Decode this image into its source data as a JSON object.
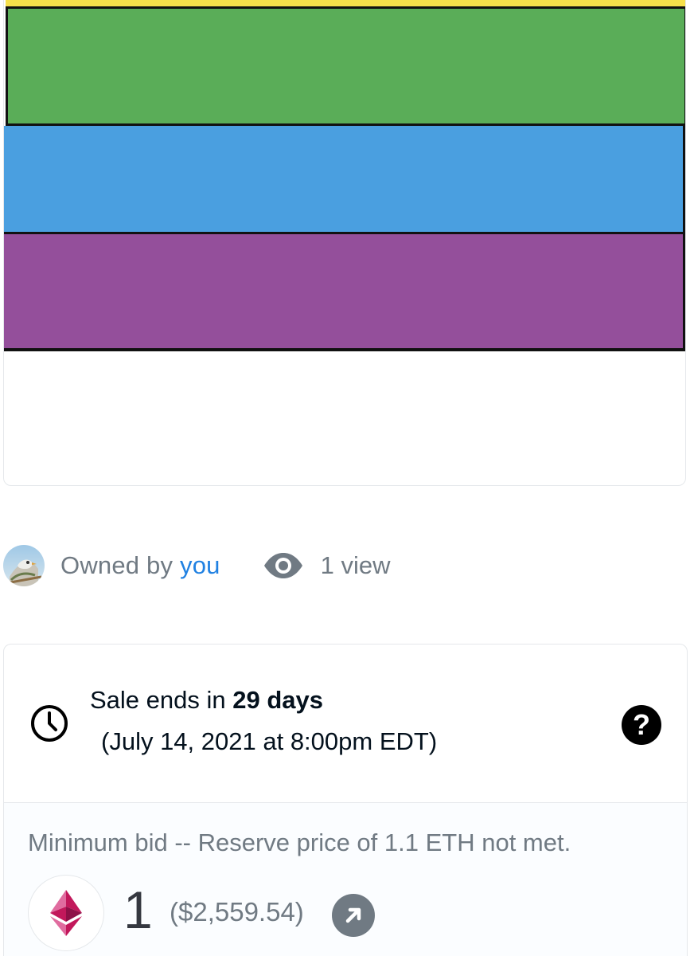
{
  "artwork": {
    "stripes": [
      {
        "name": "yellow",
        "color": "#f6e04b"
      },
      {
        "name": "green",
        "color": "#5aad58"
      },
      {
        "name": "blue",
        "color": "#4a9fe0"
      },
      {
        "name": "purple",
        "color": "#944f9b"
      }
    ]
  },
  "meta": {
    "owned_prefix": "Owned by ",
    "owner_link": "you",
    "views": "1 view",
    "avatar_icon": "avatar-bird-icon",
    "views_icon": "eye-icon"
  },
  "sale": {
    "ends_prefix": "Sale ends in ",
    "ends_bold": "29 days",
    "ends_date": "(July 14, 2021 at 8:00pm EDT)",
    "clock_icon": "clock-icon",
    "help_icon": "help-icon",
    "help_label": "?",
    "min_bid_label": "Minimum bid -- Reserve price of 1.1 ETH not met.",
    "price": "1",
    "usd": "($2,559.54)",
    "currency_icon": "ethereum-icon",
    "external_icon": "arrow-up-right-icon"
  },
  "colors": {
    "link": "#2081e2",
    "muted": "#707a83",
    "text": "#04111d",
    "border": "#e5e8eb"
  }
}
